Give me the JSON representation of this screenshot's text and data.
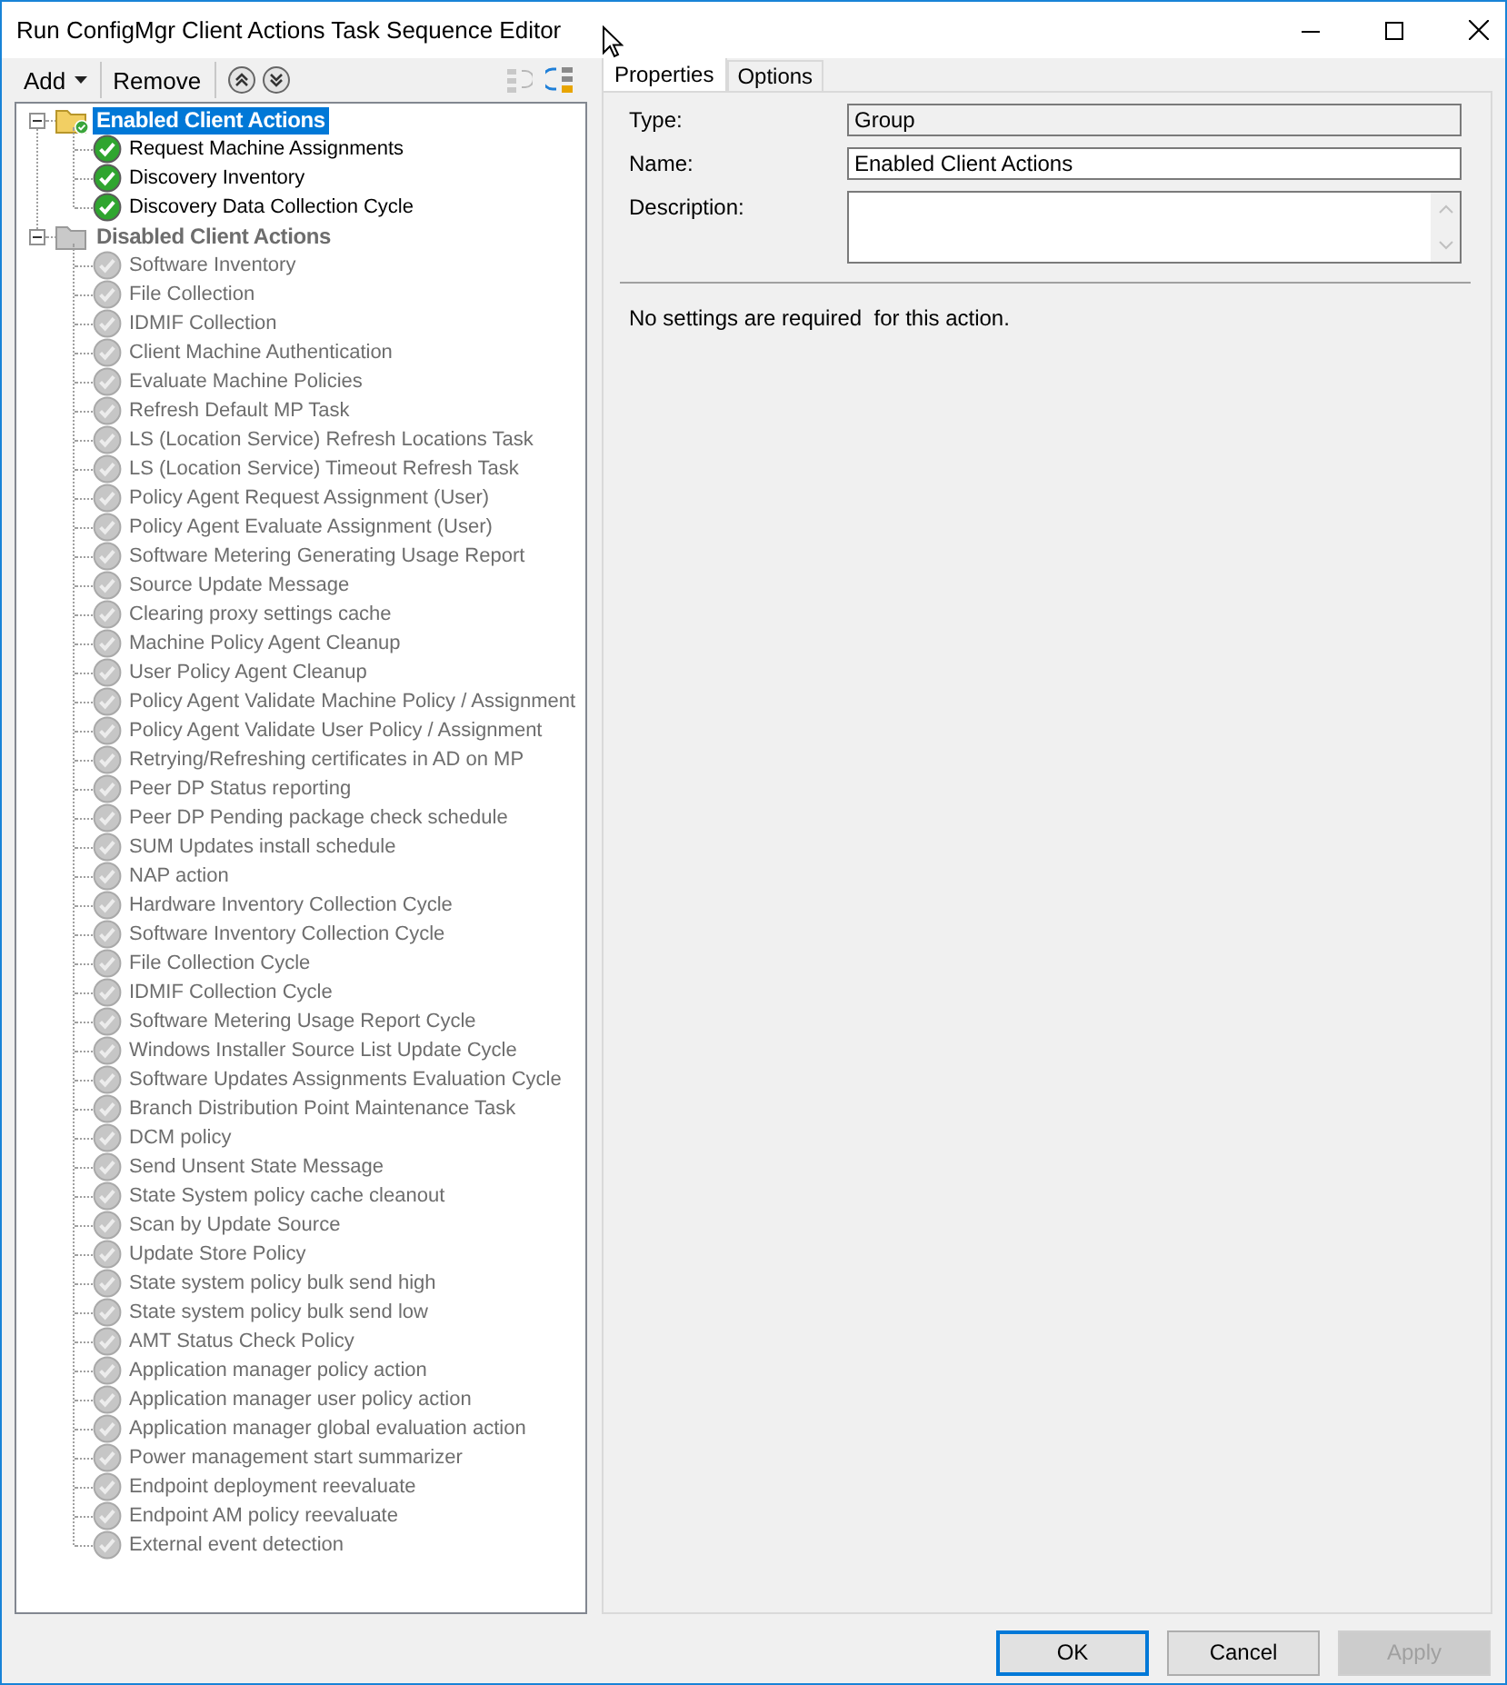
{
  "window": {
    "title": "Run ConfigMgr Client Actions Task Sequence Editor"
  },
  "toolbar": {
    "buttons": [
      {
        "kind": "menu",
        "label": "Add"
      },
      {
        "kind": "text",
        "label": "Remove"
      },
      {
        "kind": "up"
      },
      {
        "kind": "down"
      },
      {
        "kind": "ungroup",
        "disabled": true
      },
      {
        "kind": "group",
        "disabled": false
      }
    ]
  },
  "tree": [
    {
      "label": "Enabled Client Actions",
      "enabled": true,
      "selected": true,
      "expanded": true,
      "children": [
        {
          "label": "Request Machine Assignments",
          "enabled": true,
          "selected": false
        },
        {
          "label": "Discovery Inventory",
          "enabled": true,
          "selected": false
        },
        {
          "label": "Discovery Data Collection Cycle",
          "enabled": true,
          "selected": false
        }
      ]
    },
    {
      "label": "Disabled Client Actions",
      "enabled": false,
      "selected": false,
      "expanded": true,
      "children": [
        {
          "label": "Software Inventory",
          "enabled": false,
          "selected": false
        },
        {
          "label": "File Collection",
          "enabled": false,
          "selected": false
        },
        {
          "label": "IDMIF Collection",
          "enabled": false,
          "selected": false
        },
        {
          "label": "Client Machine Authentication",
          "enabled": false,
          "selected": false
        },
        {
          "label": "Evaluate Machine Policies",
          "enabled": false,
          "selected": false
        },
        {
          "label": "Refresh Default MP Task",
          "enabled": false,
          "selected": false
        },
        {
          "label": "LS (Location Service) Refresh Locations Task",
          "enabled": false,
          "selected": false
        },
        {
          "label": "LS (Location Service) Timeout Refresh Task",
          "enabled": false,
          "selected": false
        },
        {
          "label": "Policy Agent Request Assignment (User)",
          "enabled": false,
          "selected": false
        },
        {
          "label": "Policy Agent Evaluate Assignment (User)",
          "enabled": false,
          "selected": false
        },
        {
          "label": "Software Metering Generating Usage Report",
          "enabled": false,
          "selected": false
        },
        {
          "label": "Source Update Message",
          "enabled": false,
          "selected": false
        },
        {
          "label": "Clearing proxy settings cache",
          "enabled": false,
          "selected": false
        },
        {
          "label": "Machine Policy Agent Cleanup",
          "enabled": false,
          "selected": false
        },
        {
          "label": "User Policy Agent Cleanup",
          "enabled": false,
          "selected": false
        },
        {
          "label": "Policy Agent Validate Machine Policy / Assignment",
          "enabled": false,
          "selected": false
        },
        {
          "label": "Policy Agent Validate User Policy / Assignment",
          "enabled": false,
          "selected": false
        },
        {
          "label": "Retrying/Refreshing certificates in AD on MP",
          "enabled": false,
          "selected": false
        },
        {
          "label": "Peer DP Status reporting",
          "enabled": false,
          "selected": false
        },
        {
          "label": "Peer DP Pending package check schedule",
          "enabled": false,
          "selected": false
        },
        {
          "label": "SUM Updates install schedule",
          "enabled": false,
          "selected": false
        },
        {
          "label": "NAP action",
          "enabled": false,
          "selected": false
        },
        {
          "label": "Hardware Inventory Collection Cycle",
          "enabled": false,
          "selected": false
        },
        {
          "label": "Software Inventory Collection Cycle",
          "enabled": false,
          "selected": false
        },
        {
          "label": "File Collection Cycle",
          "enabled": false,
          "selected": false
        },
        {
          "label": "IDMIF Collection Cycle",
          "enabled": false,
          "selected": false
        },
        {
          "label": "Software Metering Usage Report Cycle",
          "enabled": false,
          "selected": false
        },
        {
          "label": "Windows Installer Source List Update Cycle",
          "enabled": false,
          "selected": false
        },
        {
          "label": "Software Updates Assignments Evaluation Cycle",
          "enabled": false,
          "selected": false
        },
        {
          "label": "Branch Distribution Point Maintenance Task",
          "enabled": false,
          "selected": false
        },
        {
          "label": "DCM policy",
          "enabled": false,
          "selected": false
        },
        {
          "label": "Send Unsent State Message",
          "enabled": false,
          "selected": false
        },
        {
          "label": "State System policy cache cleanout",
          "enabled": false,
          "selected": false
        },
        {
          "label": "Scan by Update Source",
          "enabled": false,
          "selected": false
        },
        {
          "label": "Update Store Policy",
          "enabled": false,
          "selected": false
        },
        {
          "label": "State system policy bulk send high",
          "enabled": false,
          "selected": false
        },
        {
          "label": "State system policy bulk send low",
          "enabled": false,
          "selected": false
        },
        {
          "label": "AMT Status Check Policy",
          "enabled": false,
          "selected": false
        },
        {
          "label": "Application manager policy action",
          "enabled": false,
          "selected": false
        },
        {
          "label": "Application manager user policy action",
          "enabled": false,
          "selected": false
        },
        {
          "label": "Application manager global evaluation action",
          "enabled": false,
          "selected": false
        },
        {
          "label": "Power management start summarizer",
          "enabled": false,
          "selected": false
        },
        {
          "label": "Endpoint deployment reevaluate",
          "enabled": false,
          "selected": false
        },
        {
          "label": "Endpoint AM policy reevaluate",
          "enabled": false,
          "selected": false
        },
        {
          "label": "External event detection",
          "enabled": false,
          "selected": false
        }
      ]
    }
  ],
  "tabs": [
    {
      "label": "Properties",
      "selected": true
    },
    {
      "label": "Options",
      "selected": false
    }
  ],
  "properties": {
    "fields": [
      {
        "kind": "readonly",
        "label": "Type:",
        "value": "Group"
      },
      {
        "kind": "text",
        "label": "Name:",
        "value": "Enabled Client Actions"
      },
      {
        "kind": "multiline",
        "label": "Description:"
      }
    ],
    "note": "No settings are required  for this action."
  },
  "buttons": [
    {
      "label": "OK",
      "default": true,
      "disabled": false
    },
    {
      "label": "Cancel",
      "default": false,
      "disabled": false
    },
    {
      "label": "Apply",
      "default": false,
      "disabled": true
    }
  ]
}
